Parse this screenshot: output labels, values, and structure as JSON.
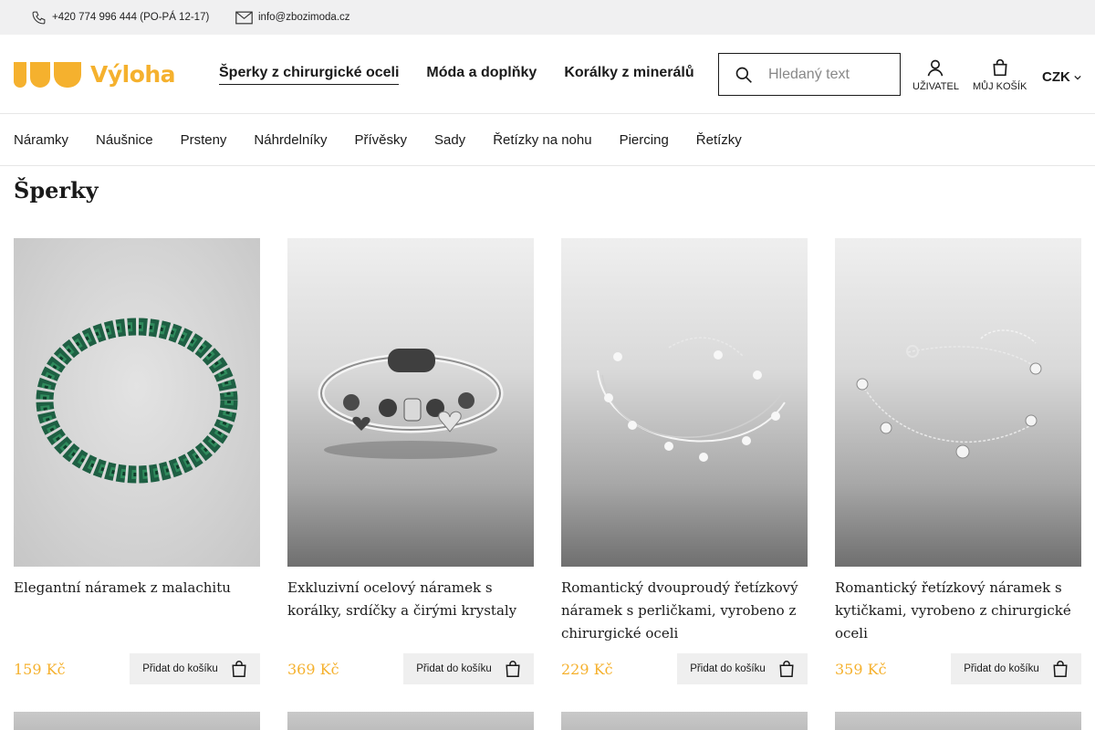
{
  "topbar": {
    "phone": "+420 774 996 444 (PO-PÁ 12-17)",
    "email": "info@zbozimoda.cz",
    "phone_icon": "phone-icon",
    "mail_icon": "mail-icon"
  },
  "header": {
    "logo_text": "Výloha",
    "brand_color": "#f5b12e",
    "nav": [
      {
        "label": "Šperky z chirurgické oceli",
        "active": true
      },
      {
        "label": "Móda a doplňky",
        "active": false
      },
      {
        "label": "Korálky z minerálů",
        "active": false
      }
    ],
    "search_placeholder": "Hledaný text",
    "user_label": "UŽIVATEL",
    "cart_label": "MŮJ KOŠÍK",
    "currency": "CZK"
  },
  "categories": [
    "Náramky",
    "Náušnice",
    "Prsteny",
    "Náhrdelníky",
    "Přívěsky",
    "Sady",
    "Řetízky na nohu",
    "Piercing",
    "Řetízky"
  ],
  "page_title": "Šperky",
  "products": [
    {
      "name": "Elegantní náramek z malachitu",
      "price": "159 Kč",
      "button": "Přidat do košíku"
    },
    {
      "name": "Exkluzivní ocelový náramek s korálky, srdíčky a čirými krystaly",
      "price": "369 Kč",
      "button": "Přidat do košíku"
    },
    {
      "name": "Romantický dvouproudý řetízkový náramek s perličkami, vyrobeno z chirurgické oceli",
      "price": "229 Kč",
      "button": "Přidat do košíku"
    },
    {
      "name": "Romantický řetízkový náramek s kytičkami, vyrobeno z chirurgické oceli",
      "price": "359 Kč",
      "button": "Přidat do košíku"
    }
  ]
}
